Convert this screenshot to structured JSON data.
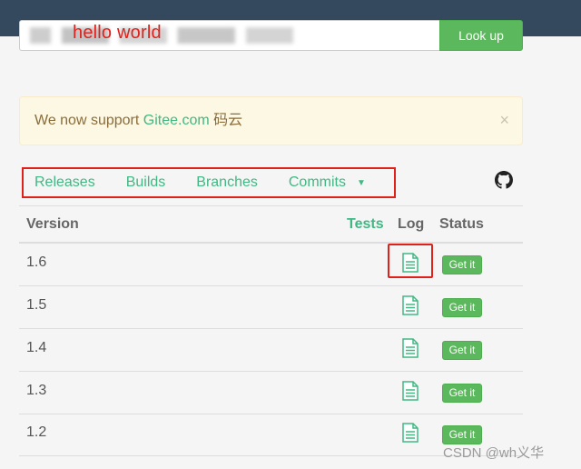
{
  "header": {
    "greeting": "hello world"
  },
  "search": {
    "value": "",
    "button_label": "Look up"
  },
  "alert": {
    "text_prefix": "We now support ",
    "link_text": "Gitee.com",
    "text_suffix": " 码云",
    "close_symbol": "×"
  },
  "tabs": [
    {
      "label": "Releases"
    },
    {
      "label": "Builds"
    },
    {
      "label": "Branches"
    },
    {
      "label": "Commits"
    }
  ],
  "table": {
    "headers": {
      "version": "Version",
      "tests": "Tests",
      "log": "Log",
      "status": "Status"
    },
    "rows": [
      {
        "version": "1.6",
        "action": "Get it"
      },
      {
        "version": "1.5",
        "action": "Get it"
      },
      {
        "version": "1.4",
        "action": "Get it"
      },
      {
        "version": "1.3",
        "action": "Get it"
      },
      {
        "version": "1.2",
        "action": "Get it"
      }
    ]
  },
  "watermark": "CSDN @wh义华",
  "colors": {
    "topbar": "#34495e",
    "accent": "#41b883",
    "button": "#5cb85c",
    "annotation": "#e0211b"
  }
}
